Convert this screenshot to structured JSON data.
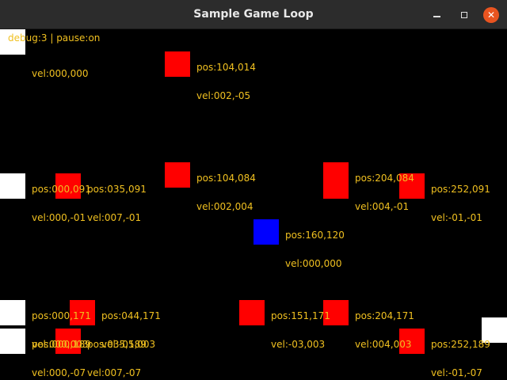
{
  "window": {
    "title": "Sample Game Loop",
    "close_glyph": "✕"
  },
  "debug": {
    "text": "debug:3 | pause:on"
  },
  "colors": {
    "red_entity": "#ff0000",
    "blue_entity": "#0000ff",
    "white_entity": "#ffffff",
    "label_text": "#f0c020",
    "background": "#000000"
  },
  "labels": [
    {
      "pos": "",
      "vel": "vel:000,000"
    },
    {
      "pos": "pos:104,014",
      "vel": "vel:002,-05"
    },
    {
      "pos": "pos:104,084",
      "vel": "vel:002,004"
    },
    {
      "pos": "pos:204,084",
      "vel": "vel:004,-01"
    },
    {
      "pos": "pos:000,091",
      "vel": "vel:000,-01"
    },
    {
      "pos": "pos:035,091",
      "vel": "vel:007,-01"
    },
    {
      "pos": "pos:252,091",
      "vel": "vel:-01,-01"
    },
    {
      "pos": "pos:160,120",
      "vel": "vel:000,000"
    },
    {
      "pos": "pos:000,171",
      "vel": "vel:000,003"
    },
    {
      "pos": "pos:044,171",
      "vel": "vel:-05,003"
    },
    {
      "pos": "pos:151,171",
      "vel": "vel:-03,003"
    },
    {
      "pos": "pos:204,171",
      "vel": "vel:004,003"
    },
    {
      "pos": "pos:000,189",
      "vel": "vel:000,-07"
    },
    {
      "pos": "pos:035,189",
      "vel": "vel:007,-07"
    },
    {
      "pos": "pos:252,189",
      "vel": "vel:-01,-07"
    }
  ]
}
